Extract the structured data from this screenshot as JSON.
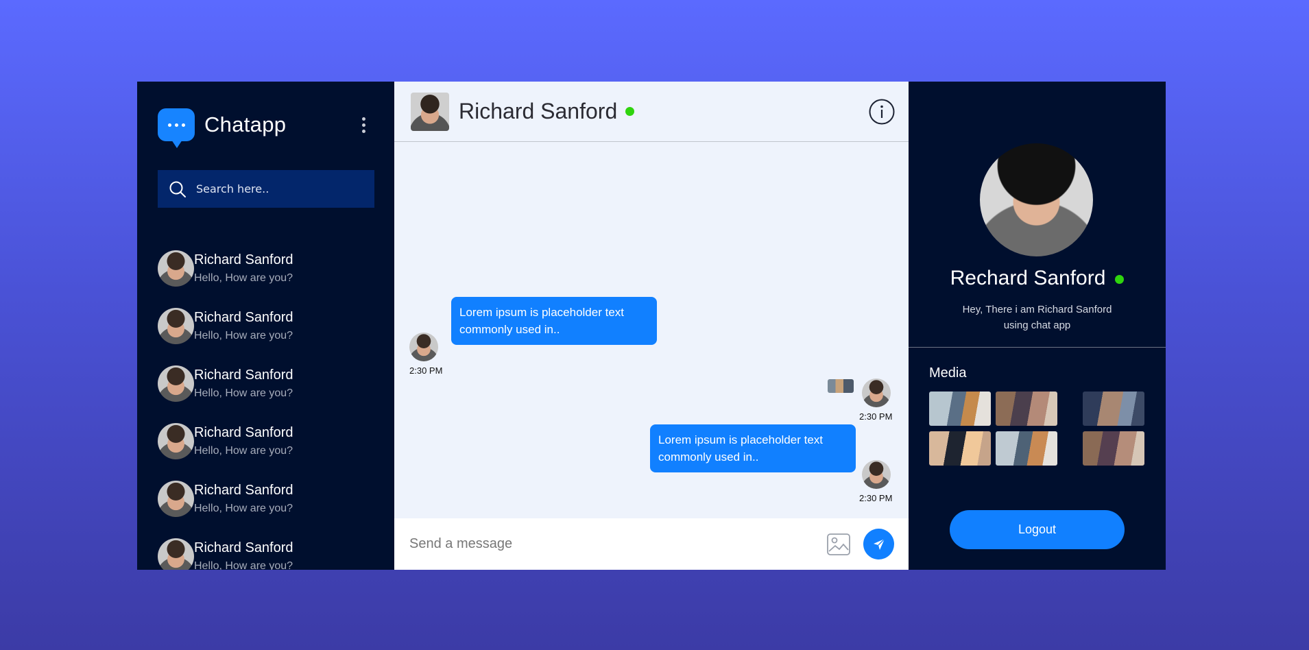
{
  "brand": {
    "name": "Chatapp",
    "logo_icon": "chat-bubble-icon",
    "accent": "#1784ff"
  },
  "search": {
    "placeholder": "Search here.."
  },
  "contacts": [
    {
      "name": "Richard Sanford",
      "preview": "Hello, How are you?"
    },
    {
      "name": "Richard Sanford",
      "preview": "Hello, How are you?"
    },
    {
      "name": "Richard Sanford",
      "preview": "Hello, How are you?"
    },
    {
      "name": "Richard Sanford",
      "preview": "Hello, How are you?"
    },
    {
      "name": "Richard Sanford",
      "preview": "Hello, How are you?"
    },
    {
      "name": "Richard Sanford",
      "preview": "Hello, How are you?"
    }
  ],
  "chat": {
    "contact_name": "Richard Sanford",
    "online_color": "#2fd40e",
    "messages": [
      {
        "text": "Lorem ipsum is placeholder text commonly used in..",
        "time": "2:30 PM",
        "side": "incoming"
      },
      {
        "type": "image",
        "time": "2:30 PM",
        "side": "outgoing"
      },
      {
        "text": "Lorem ipsum is placeholder text commonly used in..",
        "time": "2:30 PM",
        "side": "outgoing"
      }
    ],
    "composer_placeholder": "Send a message"
  },
  "profile": {
    "name": "Rechard Sanford",
    "bio": "Hey, There i am Richard Sanford using chat app",
    "media_title": "Media",
    "media_count": 6,
    "logout_label": "Logout"
  },
  "colors": {
    "sidebar_bg": "#000f2e",
    "search_bg": "#03266b",
    "chat_bg": "#eef3fc",
    "bubble": "#1180ff"
  }
}
